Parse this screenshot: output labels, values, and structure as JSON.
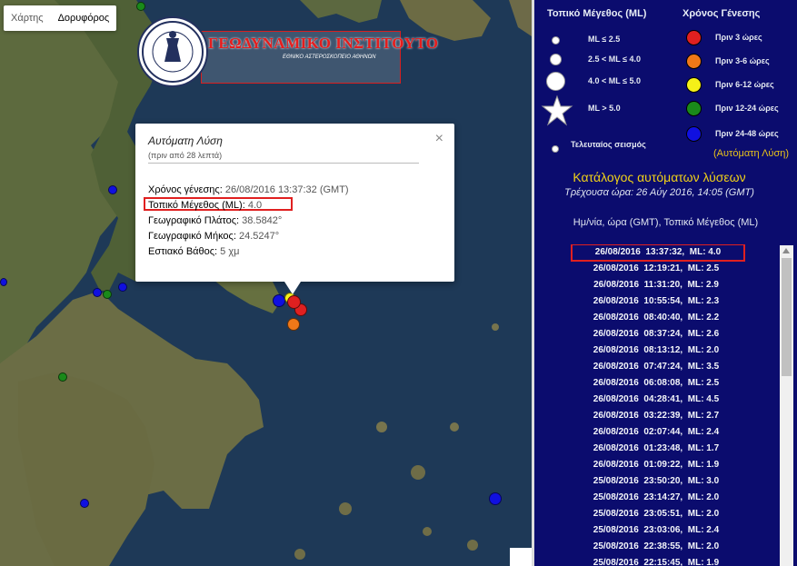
{
  "map": {
    "type_controls": [
      "Χάρτης",
      "Δορυφόρος"
    ],
    "logo": {
      "title": "ΓΕΩΔΥΝΑΜΙΚΟ ΙΝΣΤΙΤΟΥΤΟ",
      "subtitle": "ΕΘΝΙΚΟ ΑΣΤΕΡΟΣΚΟΠΕΙΟ ΑΘΗΝΩΝ"
    },
    "popup": {
      "title": "Αυτόματη Λύση",
      "subtitle": "(πριν από 28 λεπτά)",
      "close": "×",
      "rows": [
        {
          "label": "Χρόνος γένεσης:",
          "value": "26/08/2016  13:37:32 (GMT)"
        },
        {
          "label": "Τοπικό Μέγεθος (ML):",
          "value": "4.0"
        },
        {
          "label": "Γεωγραφικό Πλάτος:",
          "value": "38.5842°"
        },
        {
          "label": "Γεωγραφικό Μήκος:",
          "value": "24.5247°"
        },
        {
          "label": "Εστιακό Βάθος:",
          "value": "5 χμ"
        }
      ]
    }
  },
  "legend": {
    "size_title": "Τοπικό Μέγεθος (ML)",
    "time_title": "Χρόνος Γένεσης",
    "sizes": [
      "ML ≤ 2.5",
      "2.5 < ML ≤ 4.0",
      "4.0 < ML ≤ 5.0",
      "ML > 5.0",
      "Τελευταίος σεισμός"
    ],
    "times": [
      {
        "label": "Πριν 3 ώρες",
        "color": "#e02020"
      },
      {
        "label": "Πριν 3-6 ώρες",
        "color": "#f07818"
      },
      {
        "label": "Πριν 6-12 ώρες",
        "color": "#f5f018"
      },
      {
        "label": "Πριν 12-24 ώρες",
        "color": "#1a8a1a"
      },
      {
        "label": "Πριν 24-48 ώρες",
        "color": "#1010e0"
      }
    ],
    "automatic": "(Αυτόματη Λύση)"
  },
  "catalog": {
    "title": "Κατάλογος αυτόματων λύσεων",
    "current_time": "Τρέχουσα ώρα: 26 Αύγ 2016, 14:05 (GMT)",
    "header": "Ημ/νία, ώρα (GMT), Τοπικό Μέγεθος (ML)",
    "entries": [
      "26/08/2016  13:37:32,  ML: 4.0",
      "26/08/2016  12:19:21,  ML: 2.5",
      "26/08/2016  11:31:20,  ML: 2.9",
      "26/08/2016  10:55:54,  ML: 2.3",
      "26/08/2016  08:40:40,  ML: 2.2",
      "26/08/2016  08:37:24,  ML: 2.6",
      "26/08/2016  08:13:12,  ML: 2.0",
      "26/08/2016  07:47:24,  ML: 3.5",
      "26/08/2016  06:08:08,  ML: 2.5",
      "26/08/2016  04:28:41,  ML: 4.5",
      "26/08/2016  03:22:39,  ML: 2.7",
      "26/08/2016  02:07:44,  ML: 2.4",
      "26/08/2016  01:23:48,  ML: 1.7",
      "26/08/2016  01:09:22,  ML: 1.9",
      "25/08/2016  23:50:20,  ML: 3.0",
      "25/08/2016  23:14:27,  ML: 2.0",
      "25/08/2016  23:05:51,  ML: 2.0",
      "25/08/2016  23:03:06,  ML: 2.4",
      "25/08/2016  22:38:55,  ML: 2.0",
      "25/08/2016  22:15:45,  ML: 1.9"
    ]
  }
}
